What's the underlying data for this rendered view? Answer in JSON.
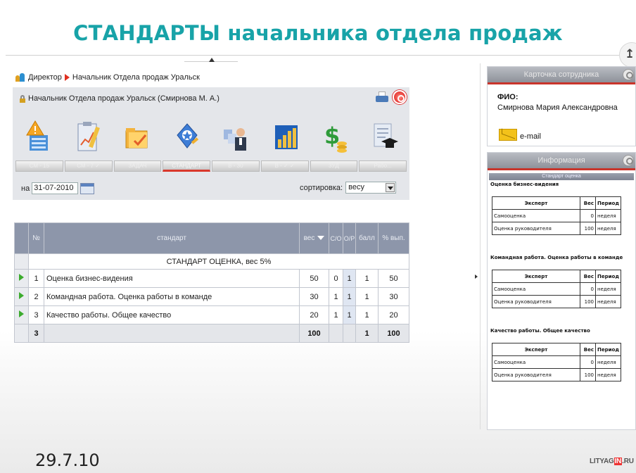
{
  "slide": {
    "title": "СТАНДАРТЫ начальника отдела продаж",
    "date": "29.7.10",
    "logo": {
      "left": "LITYAG",
      "highlight": "IN",
      "right": ".RU"
    }
  },
  "corner_button": {
    "label": "↥"
  },
  "breadcrumb": {
    "root": "Директор",
    "current": "Начальник Отдела продаж Уральск"
  },
  "panel": {
    "header": "Начальник Отдела продаж Уральск  (Смирнова М. А.)",
    "icons": [
      "warning-list-icon",
      "clipboard-chart-icon",
      "folder-check-icon",
      "award-badge-icon",
      "team-person-icon",
      "bar-chart-icon",
      "dollar-coins-icon",
      "graduation-scroll-icon"
    ],
    "tabs": [
      "СМ - 15",
      "СМ - 7 ✓",
      "ЗАДАЧ",
      "СТАНДАРТ",
      "В - 30",
      "В - ✓ ✓",
      "ЗУД",
      "Рабо..."
    ],
    "active_tab": 3,
    "date_label": "на",
    "date_value": "31-07-2010",
    "sort_label": "сортировка:",
    "sort_value": "весу"
  },
  "table": {
    "headers": {
      "num": "№",
      "standard": "стандарт",
      "weight": "вес",
      "so": "С/О",
      "op": "О/Р",
      "score": "балл",
      "pct": "% вып."
    },
    "section": "СТАНДАРТ ОЦЕНКА, вес 5%",
    "rows": [
      {
        "num": "1",
        "name": "Оценка бизнес-видения",
        "weight": "50",
        "so": "0",
        "op": "1",
        "score": "1",
        "pct": "50"
      },
      {
        "num": "2",
        "name": "Командная работа. Оценка работы в команде",
        "weight": "30",
        "so": "1",
        "op": "1",
        "score": "1",
        "pct": "30"
      },
      {
        "num": "3",
        "name": "Качество работы. Общее качество",
        "weight": "20",
        "so": "1",
        "op": "1",
        "score": "1",
        "pct": "20"
      }
    ],
    "footer": {
      "num": "3",
      "weight": "100",
      "score": "1",
      "pct": "100"
    }
  },
  "employee_card": {
    "title": "Карточка сотрудника",
    "fio_label": "ФИО:",
    "fio_value": "Смирнова Мария Александровна",
    "email": "e-mail"
  },
  "info_card": {
    "title": "Информация",
    "subtitle": "Стандарт оценка",
    "blocks": [
      {
        "title": "Оценка бизнес-видения",
        "head": [
          "Эксперт",
          "Вес",
          "Период"
        ],
        "rows": [
          [
            "Самооценка",
            "0",
            "неделя"
          ],
          [
            "Оценка руководителя",
            "100",
            "неделя"
          ]
        ]
      },
      {
        "title": "Командная работа. Оценка работы в команде",
        "head": [
          "Эксперт",
          "Вес",
          "Период"
        ],
        "rows": [
          [
            "Самооценка",
            "0",
            "неделя"
          ],
          [
            "Оценка руководителя",
            "100",
            "неделя"
          ]
        ]
      },
      {
        "title": "Качество работы. Общее качество",
        "head": [
          "Эксперт",
          "Вес",
          "Период"
        ],
        "rows": [
          [
            "Самооценка",
            "0",
            "неделя"
          ],
          [
            "Оценка руководителя",
            "100",
            "неделя"
          ]
        ]
      }
    ]
  }
}
